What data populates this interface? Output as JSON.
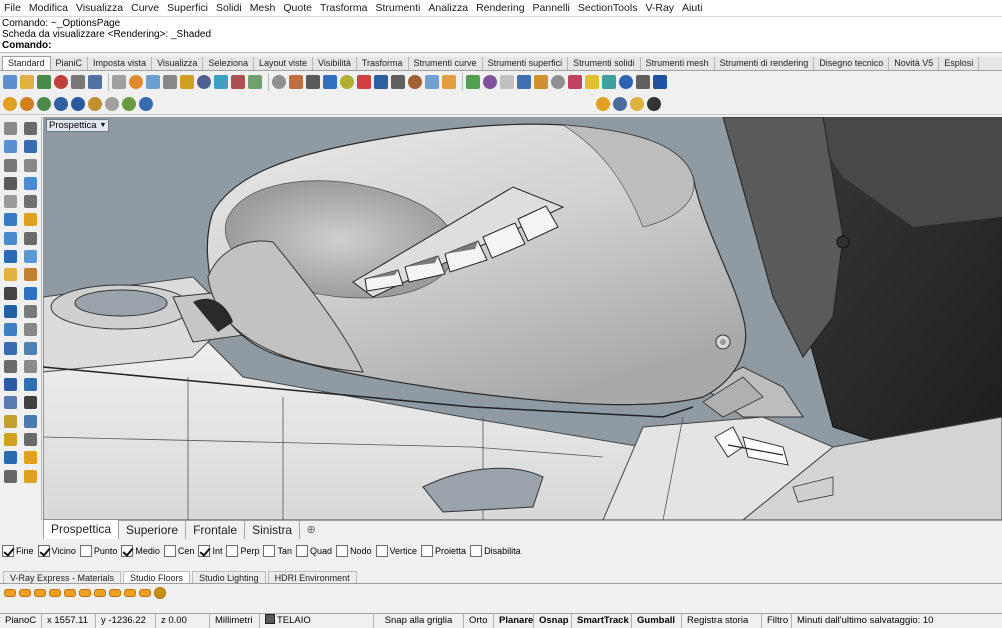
{
  "menu": [
    "File",
    "Modifica",
    "Visualizza",
    "Curve",
    "Superfici",
    "Solidi",
    "Mesh",
    "Quote",
    "Trasforma",
    "Strumenti",
    "Analizza",
    "Rendering",
    "Pannelli",
    "SectionTools",
    "V-Ray",
    "Aiuti"
  ],
  "command": {
    "history1": "Comando: ~_OptionsPage",
    "history2": "Scheda da visualizzare <Rendering>: _Shaded",
    "prompt": "Comando:"
  },
  "tabs": [
    "Standard",
    "PianiC",
    "Imposta vista",
    "Visualizza",
    "Seleziona",
    "Layout viste",
    "Visibilità",
    "Trasforma",
    "Strumenti curve",
    "Strumenti superfici",
    "Strumenti solidi",
    "Strumenti mesh",
    "Strumenti di rendering",
    "Disegno tecnico",
    "Novità V5",
    "Esplosi"
  ],
  "viewport": {
    "label": "Prospettica",
    "bg_color": "#8f9aa3"
  },
  "view_tabs": [
    "Prospettica",
    "Superiore",
    "Frontale",
    "Sinistra"
  ],
  "osnaps": [
    {
      "label": "Fine",
      "checked": true
    },
    {
      "label": "Vicino",
      "checked": true
    },
    {
      "label": "Punto",
      "checked": false
    },
    {
      "label": "Medio",
      "checked": true
    },
    {
      "label": "Cen",
      "checked": false
    },
    {
      "label": "Int",
      "checked": true
    },
    {
      "label": "Perp",
      "checked": false
    },
    {
      "label": "Tan",
      "checked": false
    },
    {
      "label": "Quad",
      "checked": false
    },
    {
      "label": "Nodo",
      "checked": false
    },
    {
      "label": "Vertice",
      "checked": false
    },
    {
      "label": "Proietta",
      "checked": false
    },
    {
      "label": "Disabilita",
      "checked": false
    }
  ],
  "panel_tabs": [
    "V-Ray Express - Materials",
    "Studio Floors",
    "Studio Lighting",
    "HDRI Environment"
  ],
  "status": {
    "plane": "PianoC",
    "x": "x 1557.11",
    "y": "y -1236.22",
    "z": "z 0.00",
    "units": "Millimetri",
    "layer": "TELAIO",
    "layer_color": "#5a5a5a",
    "snap": "Snap alla griglia",
    "ortho": "Orto",
    "planar": "Planare",
    "osnap": "Osnap",
    "smarttrack": "SmartTrack",
    "gumball": "Gumball",
    "history": "Registra storia",
    "filter": "Filtro",
    "autosave": "Minuti dall'ultimo salvataggio: 10"
  }
}
